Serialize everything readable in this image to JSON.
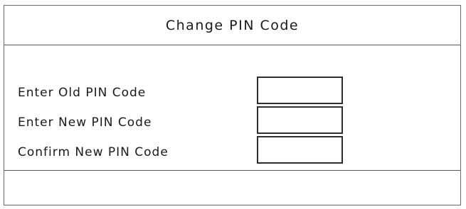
{
  "dialog": {
    "title": "Change PIN Code",
    "fields": [
      {
        "label": "Enter Old PIN Code",
        "value": ""
      },
      {
        "label": "Enter New PIN Code",
        "value": ""
      },
      {
        "label": "Confirm New PIN Code",
        "value": ""
      }
    ]
  }
}
